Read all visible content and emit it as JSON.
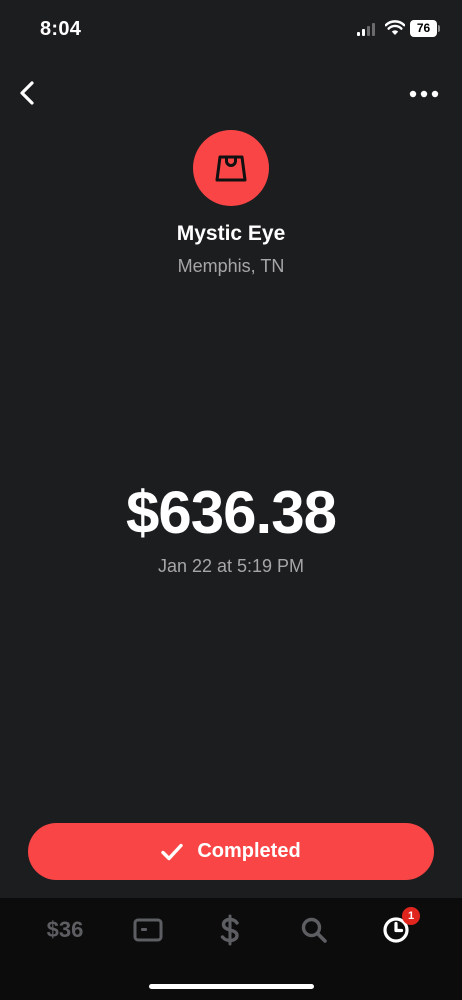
{
  "status_bar": {
    "time": "8:04",
    "battery": "76"
  },
  "merchant": {
    "name": "Mystic Eye",
    "location": "Memphis, TN",
    "avatar_icon": "shopping-bag-icon",
    "avatar_color": "#fa4546"
  },
  "transaction": {
    "amount": "$636.38",
    "date": "Jan 22 at 5:19 PM",
    "status_label": "Completed"
  },
  "tab_bar": {
    "balance_label": "$36",
    "tabs": [
      "balance",
      "card-icon",
      "dollar-icon",
      "search-icon",
      "activity-clock-icon"
    ],
    "activity_badge": "1",
    "inactive_color": "#5d5e62",
    "active_color": "#ffffff"
  },
  "colors": {
    "background": "#1c1d1f",
    "accent": "#fa4546",
    "secondary_text": "#a6a6a8"
  }
}
